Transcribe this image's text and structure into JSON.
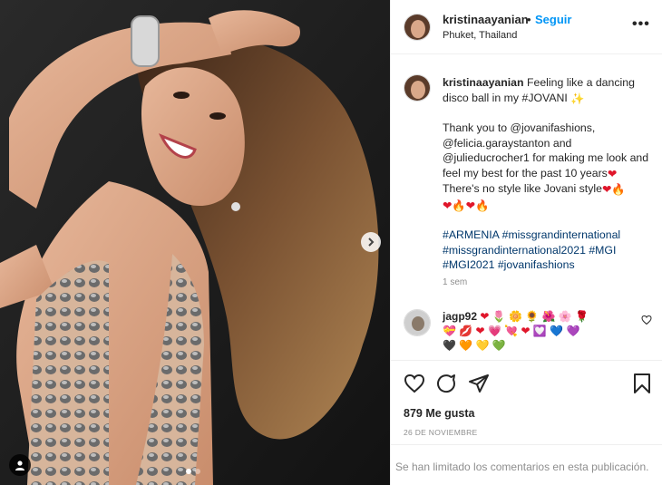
{
  "post": {
    "username": "kristinaayanian",
    "bullet": "•",
    "follow_label": "Seguir",
    "location": "Phuket, Thailand",
    "more_label": "•••"
  },
  "caption": {
    "username": "kristinaayanian",
    "line1": "Feeling like a dancing disco ball in my #JOVANI",
    "line2a": "Thank you to @jovanifashions,",
    "line2b": "@felicia.garaystanton and",
    "line2c": "@julieducrocher1 for making me look and",
    "line2d": "feel my best for the past 10 years",
    "line3": "There's no style like Jovani style",
    "tags1": "#ARMENIA #missgrandinternational",
    "tags2": "#missgrandinternational2021 #MGI",
    "tags3": "#MGI2021 #jovanifashions",
    "age": "1 sem"
  },
  "comment": {
    "username": "jagp92"
  },
  "stats": {
    "likes": "879 Me gusta",
    "date": "26 DE NOVIEMBRE"
  },
  "footer": {
    "limited": "Se han limitado los comentarios en esta publicación."
  },
  "icons": {
    "accent": "#0095f6",
    "heart_color": "#ed4956"
  }
}
